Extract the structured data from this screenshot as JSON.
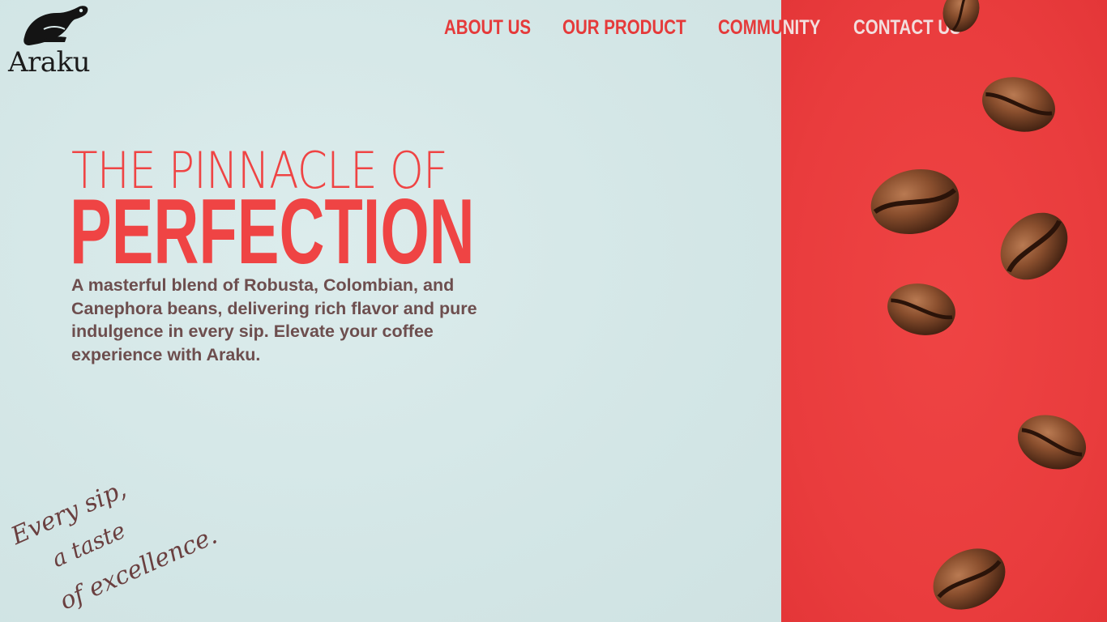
{
  "brand": {
    "name": "Araku",
    "logo_icon": "bird-mark-icon"
  },
  "nav": {
    "items": [
      {
        "label": "ABOUT US"
      },
      {
        "label": "OUR PRODUCT"
      },
      {
        "label": "COMMUNITY",
        "label_part_a": "COMMU",
        "label_part_b": "NITY"
      },
      {
        "label": "CONTACT US"
      }
    ]
  },
  "hero": {
    "headline_line1": "THE PINNACLE OF",
    "headline_line2": "PERFECTION",
    "description": "A masterful blend of Robusta, Colombian, and Canephora beans, delivering rich flavor and pure indulgence in every sip. Elevate your coffee experience with Araku."
  },
  "tagline": {
    "line1": "Every sip,",
    "line2": "a taste",
    "line3": "of excellence."
  },
  "colors": {
    "accent_red": "#ef4444",
    "background_mint": "#d6e8e8",
    "text_brown": "#6d4e4e",
    "nav_light": "#f2dede"
  },
  "decor": {
    "bean_icon": "coffee-bean-icon"
  }
}
